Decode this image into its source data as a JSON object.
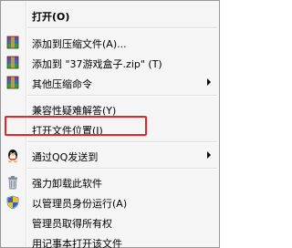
{
  "menu": {
    "items": [
      {
        "label": "打开(O)",
        "bold": true,
        "icon": "none"
      },
      {
        "label": "添加到压缩文件(A)...",
        "icon": "winrar-archive-icon"
      },
      {
        "label": "添加到 \"37游戏盒子.zip\" (T)",
        "icon": "winrar-archive-icon"
      },
      {
        "label": "其他压缩命令",
        "icon": "winrar-archive-icon",
        "submenu": true
      },
      {
        "label": "兼容性疑难解答(Y)",
        "icon": "none"
      },
      {
        "label": "打开文件位置(I)",
        "icon": "none",
        "highlighted": true
      },
      {
        "label": "通过QQ发送到",
        "icon": "qq-penguin-icon",
        "submenu": true
      },
      {
        "label": "强力卸载此软件",
        "icon": "trash-bin-icon"
      },
      {
        "label": "以管理员身份运行(A)",
        "icon": "uac-shield-icon"
      },
      {
        "label": "管理员取得所有权",
        "icon": "none"
      },
      {
        "label": "用记事本打开该文件",
        "icon": "none"
      }
    ]
  },
  "colors": {
    "highlight_border": "#e8232a",
    "menu_background": "#f5f5f5"
  }
}
